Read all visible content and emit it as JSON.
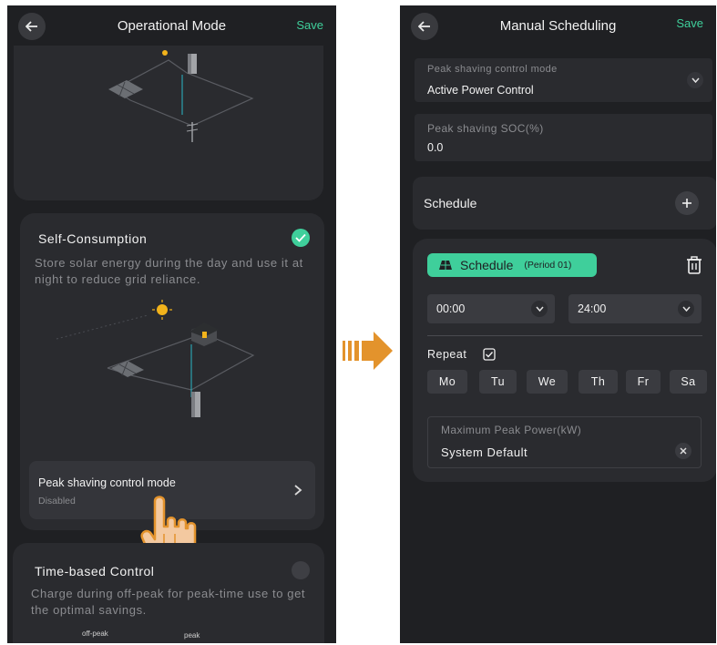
{
  "left": {
    "title": "Operational Mode",
    "save": "Save",
    "self_consumption": {
      "title": "Self-Consumption",
      "desc": "Store solar energy during the day and use it at night to reduce grid reliance."
    },
    "peak_row": {
      "label": "Peak shaving control mode",
      "value": "Disabled"
    },
    "time_based": {
      "title": "Time-based Control",
      "desc": "Charge during off-peak for peak-time use to get the optimal savings.",
      "off_peak": "off-peak",
      "peak": "peak"
    }
  },
  "right": {
    "title": "Manual Scheduling",
    "save": "Save",
    "peak_mode": {
      "label": "Peak shaving control mode",
      "value": "Active Power Control"
    },
    "peak_soc": {
      "label": "Peak shaving SOC(%)",
      "value": "0.0"
    },
    "schedule_header": "Schedule",
    "period": {
      "label": "Schedule",
      "tag": "(Period 01)",
      "start": "00:00",
      "end": "24:00"
    },
    "repeat": "Repeat",
    "days": [
      "Mo",
      "Tu",
      "We",
      "Th",
      "Fr",
      "Sa"
    ],
    "max_power": {
      "label": "Maximum Peak Power(kW)",
      "value": "System Default"
    }
  },
  "colors": {
    "accent": "#3fcf9b",
    "arrow": "#e3932c",
    "card": "#2a2b2f",
    "background": "#1f2023"
  }
}
